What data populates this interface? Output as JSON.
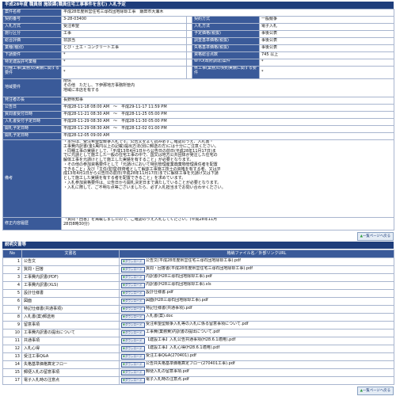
{
  "page": {
    "header_title": "平成28年度 職員宿 施設課(職員住宅工事事件を含む) 入札予定",
    "doc_section_title": "説明文書等",
    "top_button": "一覧ページへ戻る"
  },
  "info": {
    "rows": [
      {
        "type": "full",
        "label": "案件名称",
        "value": "平成28年度県営住宅三尋石団地除却工事　飯田市大瀬木"
      },
      {
        "type": "pair",
        "label": "契約番号",
        "value": "3-28-03400",
        "label2": "契約方式",
        "value2": "一般競争"
      },
      {
        "type": "pair",
        "label": "入札方式",
        "value": "受注希望",
        "label2": "入札方法",
        "value2": "電子入札"
      },
      {
        "type": "pair",
        "label": "施行区分",
        "value": "工事",
        "label2": "予定価格(税抜)",
        "value2": "事後公表"
      },
      {
        "type": "pair",
        "label": "総合評価",
        "value": "非該当",
        "label2": "調査基準価格(税抜)",
        "value2": "事後公表"
      },
      {
        "type": "pair",
        "label": "業種(種別)",
        "value": "とび・土工・コンクリート工事",
        "label2": "失格基準価格(税抜)",
        "value2": "事後公表"
      },
      {
        "type": "pair",
        "label": "下請要件",
        "value": "*",
        "label2": "資格総合点数",
        "value2": "745 以上"
      },
      {
        "type": "pair",
        "label": "特定建設許可業種",
        "value": "*",
        "label2": "WTO(政府調達)案件",
        "value2": "*"
      },
      {
        "type": "pair",
        "label": "同種工事(業務)の実績に関する要件",
        "value": "*",
        "label2": "県工事(業務)の契約実績に関する要件",
        "value2": "*"
      },
      {
        "type": "full",
        "label": "地域要件",
        "value": "南信\nその他　ただし、下伊那地方事務所管内\n地域に本店を有する"
      },
      {
        "type": "full",
        "label": "発注者の長",
        "value": "長野県知事"
      },
      {
        "type": "full",
        "label": "公告日",
        "value": "平成28-11-18 08:00 AM　〜　平成29-11-17 11:59 PM"
      },
      {
        "type": "full",
        "label": "質問書受付日時",
        "value": "平成28-11-21 08:30 AM　〜　平成28-11-25 05:00 PM"
      },
      {
        "type": "full",
        "label": "入札書受付予定日時",
        "value": "平成28-11-29 08:30 AM　〜　平成28-11-30 05:00 PM"
      },
      {
        "type": "full",
        "label": "開札予定日時",
        "value": "平成28-11-29 08:30 AM　〜　平成28-12-02 01:00 PM"
      },
      {
        "type": "full",
        "label": "開札予定日時",
        "value": "平成28-12-05 09:00 AM"
      },
      {
        "type": "full",
        "label": "備考",
        "value": "・本件は、受注希望型競争入札です。公告文をよく読み必ずご確認のうえ、入札書・\n工事費内訳書(金1萬円以上の記載)提出方法(別に郵送の方)には十分にご注意ください。\n・同種工事の実績として、「平成13年4月1日から公告日の前日(平成28年11月17日)ま\nでに元請として施工した一般の住宅工事の中で、国又は地方公共団体が発注した住宅の\n解体工事を元請けとして施工した実績を有すること」が必要となります。\n・その他の参加資格要件として「元請けにおいて特別管理産業廃棄物管理責任者を配置\nできること」及び「主任(監理)技術者として解体工事施工技士の資格を有する者、又は平\n成13年4月1日から公告日の前日(平成28年11月17日)までに解体工事を元請け又は下請\nとして施工した実績を有する者を配置できること」を求めています。\n・入札参加資格要件は、公告日から開札決定日まで満たしていることが必要となります。\n・入札に際して、ご不明な点等ございましたら、必ず入札担当までお問い合わせください。",
        "tall": true
      },
      {
        "type": "full",
        "label": "修正内容履歴",
        "value": "「質問・回答」を掲載しましたので、ご確認のうえ入札してください。(平成28年11月\n28日8時30分)"
      }
    ]
  },
  "docs": {
    "headers": [
      "No",
      "文書名",
      "格納ファイル名／外部リンクURL"
    ],
    "download_label": "ダウンロード",
    "rows": [
      {
        "no": "1",
        "name": "公告文",
        "file": "公告文(平成28年度県営住宅三尋石団地除却工事).pdf"
      },
      {
        "no": "2",
        "name": "質問・回答",
        "file": "質問・回答書(平成28年度県営住宅三尋石団地除却工事).pdf"
      },
      {
        "no": "3",
        "name": "工事費内訳書(PDF)",
        "file": "内訳書(H28三尋石団地除却工事).pdf"
      },
      {
        "no": "4",
        "name": "工事費内訳書(XLS)",
        "file": "内訳書(H28三尋石団地除却工事).xls"
      },
      {
        "no": "5",
        "name": "設計仕様書",
        "file": "設計仕様書.pdf"
      },
      {
        "no": "6",
        "name": "図面",
        "file": "図面(H28三尋石団地除却工事).pdf"
      },
      {
        "no": "7",
        "name": "特記仕様書(共通事項)",
        "file": "特記仕様書(共通事項).pdf"
      },
      {
        "no": "8",
        "name": "入札書(案)郵送用",
        "file": "入札書(案).doc"
      },
      {
        "no": "9",
        "name": "留意事項",
        "file": "受注希望型競争入札等の入札に係る留意事項について.pdf"
      },
      {
        "no": "10",
        "name": "工事費内訳書の提出について",
        "file": "工事費(業務費)内訳書の提出について.pdf"
      },
      {
        "no": "11",
        "name": "共通事項",
        "file": "【建設工事】入札公告共通事項(H28.6.1適用).pdf"
      },
      {
        "no": "12",
        "name": "入札心得",
        "file": "【建設工事】入札心得(H28.6.1適用).pdf"
      },
      {
        "no": "13",
        "name": "受注工事Q&A",
        "file": "受注工事Q&A(270401).pdf"
      },
      {
        "no": "14",
        "name": "失格基準価格算定フロー",
        "file": "公告共失格基準価格算定フロー(270401工事).pdf"
      },
      {
        "no": "15",
        "name": "郵便入札の留意事項",
        "file": "郵便入札の留意事項.pdf"
      },
      {
        "no": "17",
        "name": "電子入札時の注意点",
        "file": "電子入札時の注意点.pdf"
      }
    ]
  }
}
